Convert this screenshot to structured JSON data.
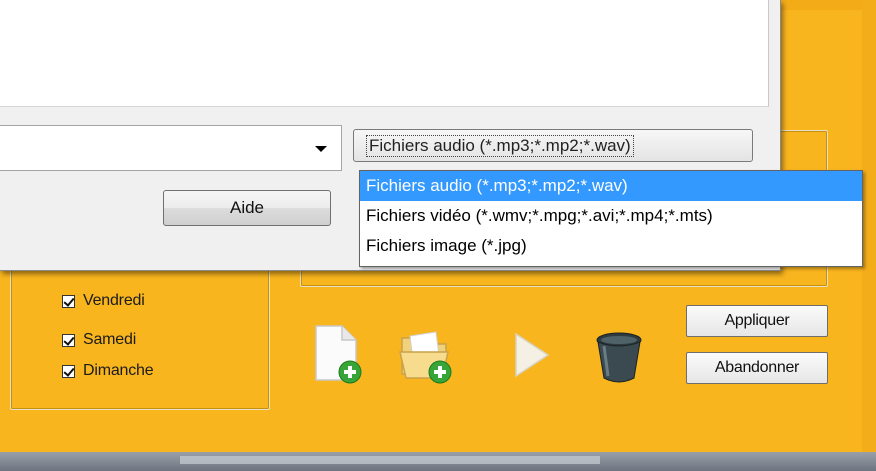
{
  "background_app": {
    "days": [
      {
        "label": "Vendredi",
        "checked": true
      },
      {
        "label": "Samedi",
        "checked": true
      },
      {
        "label": "Dimanche",
        "checked": true
      }
    ],
    "buttons": {
      "apply": "Appliquer",
      "abort": "Abandonner"
    },
    "icons": [
      "new-file-icon",
      "add-folder-icon",
      "play-icon",
      "trash-bin-icon"
    ]
  },
  "dialog": {
    "help_button": "Aide",
    "filename_value": "",
    "file_type": {
      "selected": "Fichiers audio (*.mp3;*.mp2;*.wav)",
      "options": [
        "Fichiers audio (*.mp3;*.mp2;*.wav)",
        "Fichiers vidéo (*.wmv;*.mpg;*.avi;*.mp4;*.mts)",
        "Fichiers image (*.jpg)"
      ]
    }
  },
  "colors": {
    "app_background": "#f9b51e",
    "selection": "#3399ff",
    "dialog_background": "#f0f0f0"
  }
}
